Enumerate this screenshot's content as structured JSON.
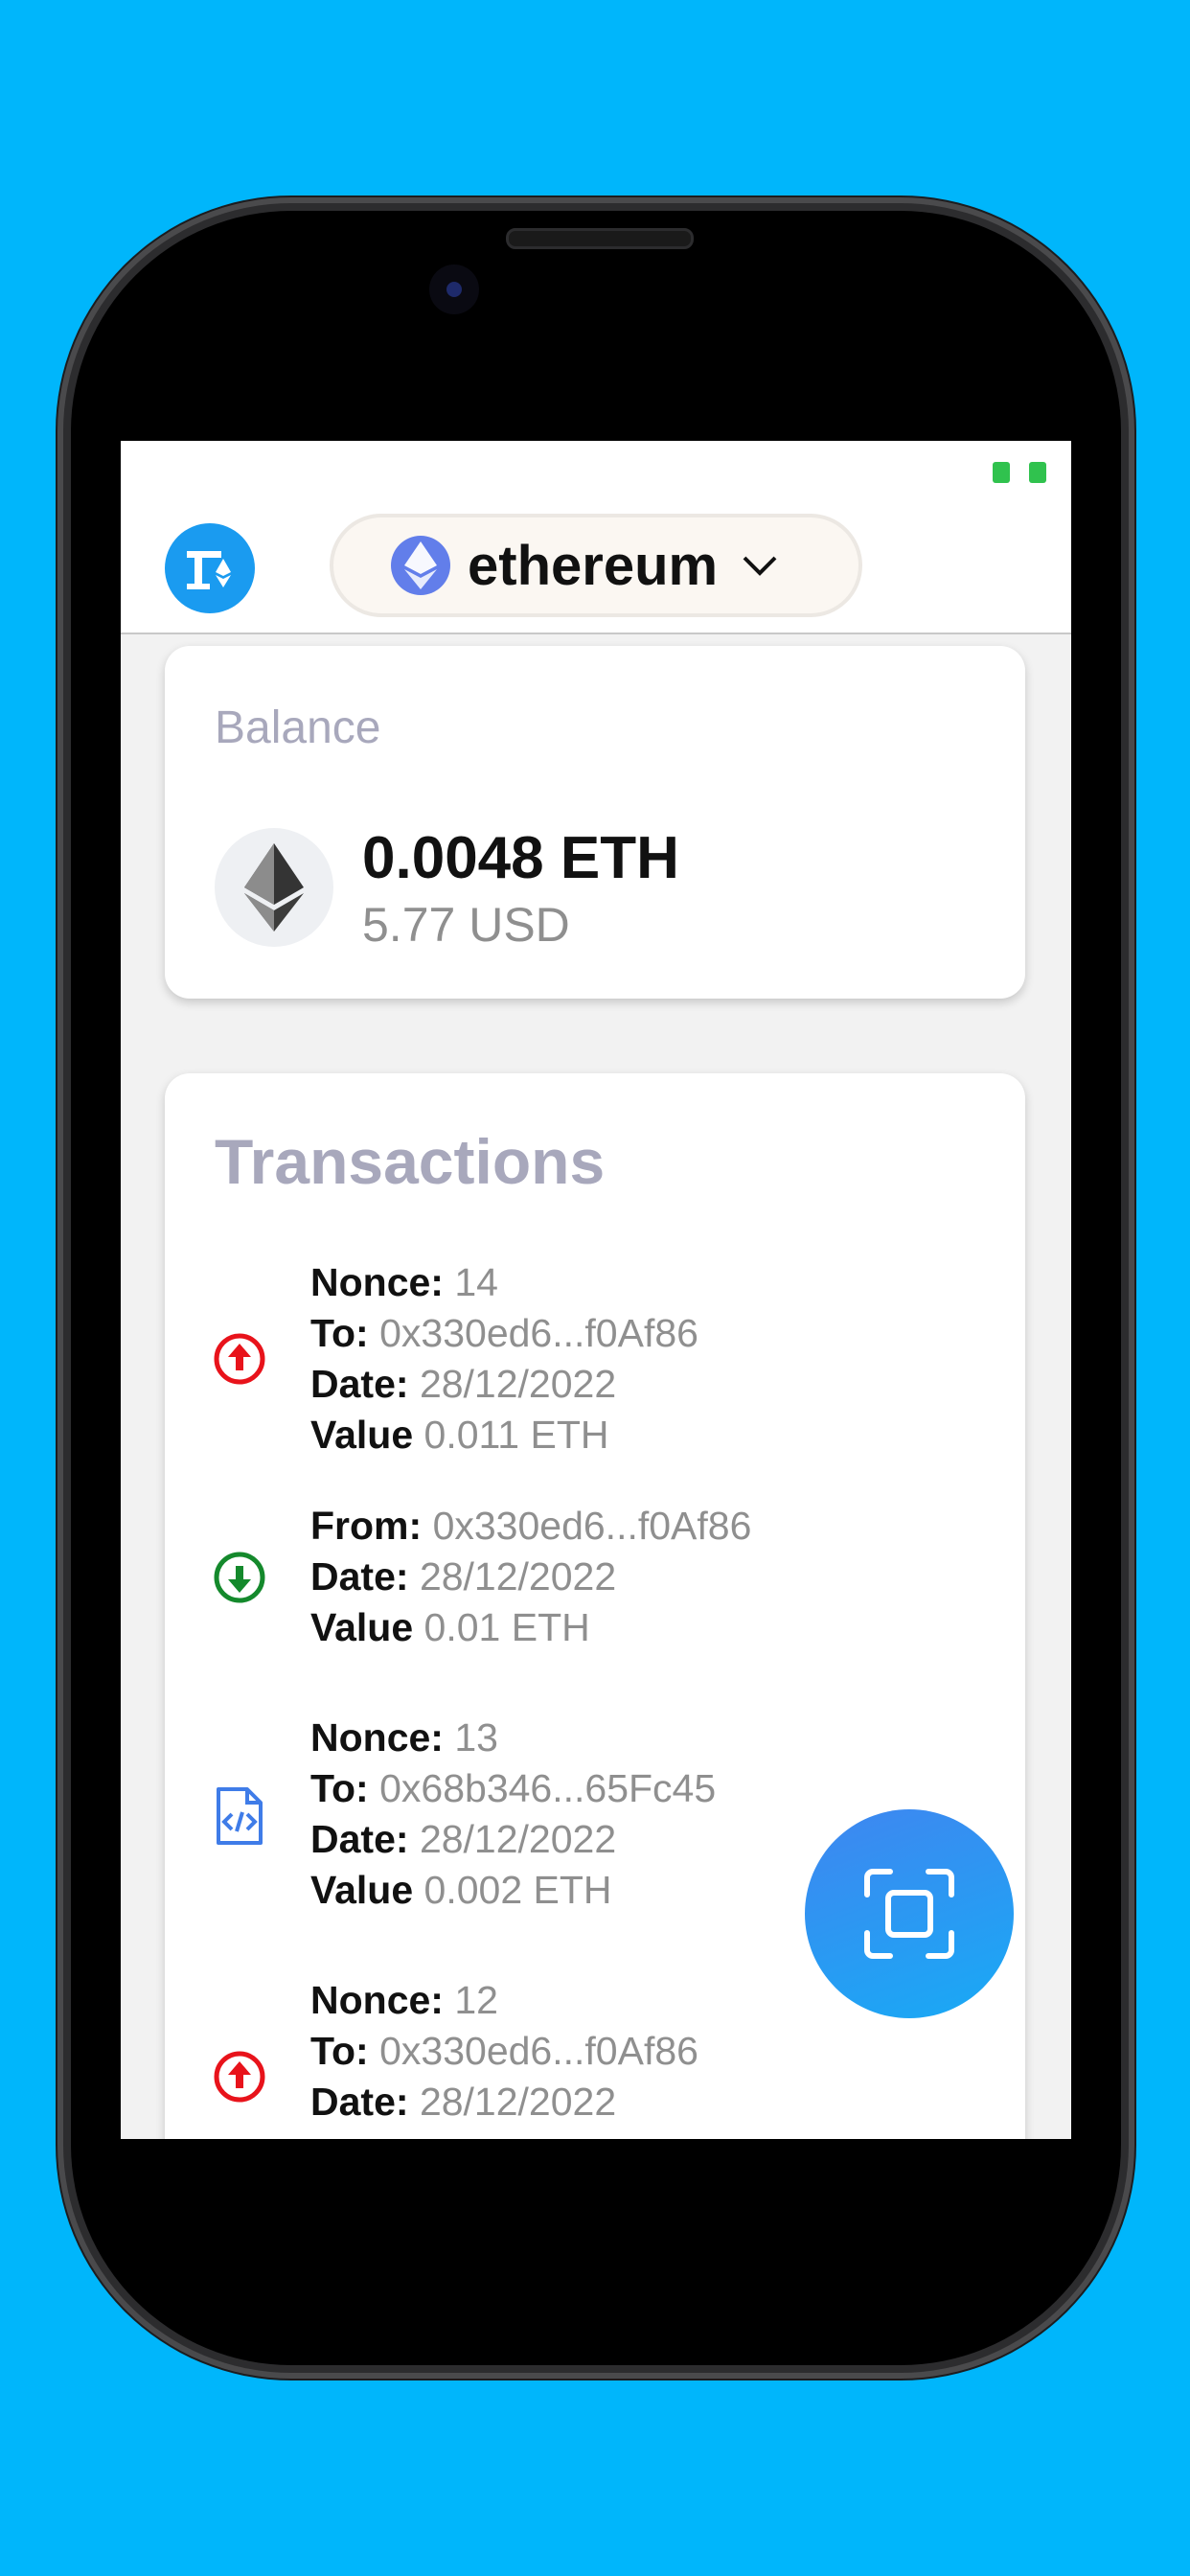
{
  "header": {
    "network": {
      "label": "ethereum"
    }
  },
  "balance": {
    "title": "Balance",
    "amount": "0.0048 ETH",
    "fiat": "5.77 USD"
  },
  "transactions": {
    "title": "Transactions",
    "items": [
      {
        "icon": "sent-arrow-up-icon",
        "lines": [
          {
            "key": "Nonce:",
            "value": "14"
          },
          {
            "key": "To:",
            "value": "0x330ed6...f0Af86"
          },
          {
            "key": "Date:",
            "value": "28/12/2022"
          },
          {
            "key": "Value",
            "value": "0.011 ETH"
          }
        ]
      },
      {
        "icon": "received-arrow-down-icon",
        "lines": [
          {
            "key": "From:",
            "value": "0x330ed6...f0Af86"
          },
          {
            "key": "Date:",
            "value": "28/12/2022"
          },
          {
            "key": "Value",
            "value": "0.01 ETH"
          }
        ]
      },
      {
        "icon": "contract-code-icon",
        "lines": [
          {
            "key": "Nonce:",
            "value": "13"
          },
          {
            "key": "To:",
            "value": "0x68b346...65Fc45"
          },
          {
            "key": "Date:",
            "value": "28/12/2022"
          },
          {
            "key": "Value",
            "value": "0.002 ETH"
          }
        ]
      },
      {
        "icon": "sent-arrow-up-icon",
        "lines": [
          {
            "key": "Nonce:",
            "value": "12"
          },
          {
            "key": "To:",
            "value": "0x330ed6...f0Af86"
          },
          {
            "key": "Date:",
            "value": "28/12/2022"
          }
        ]
      }
    ]
  },
  "colors": {
    "background": "#00b6fb",
    "sent": "#e8131b",
    "received": "#14892c",
    "contract": "#3f7ce8",
    "accent": "#1a9bf0"
  }
}
